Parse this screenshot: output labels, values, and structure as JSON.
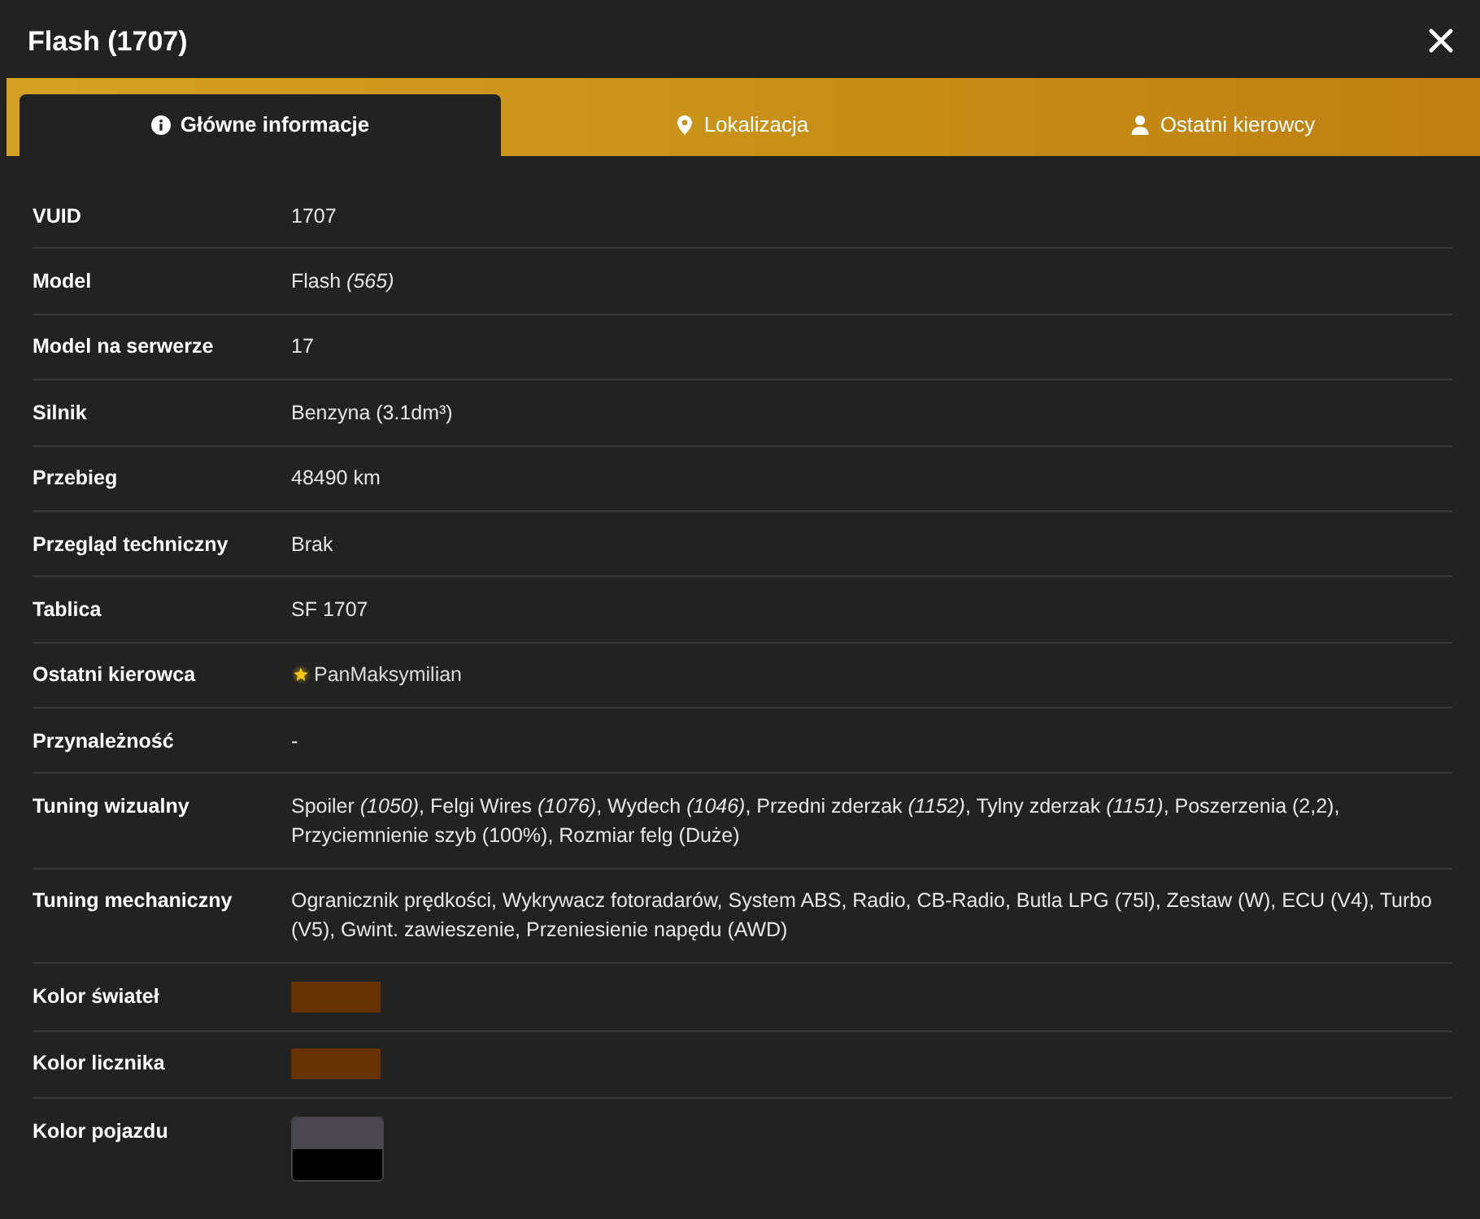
{
  "window": {
    "title": "Flash (1707)"
  },
  "tabs": [
    {
      "label": "Główne informacje",
      "selected": true
    },
    {
      "label": "Lokalizacja",
      "selected": false
    },
    {
      "label": "Ostatni kierowcy",
      "selected": false
    }
  ],
  "rows": [
    {
      "kind": "text",
      "label": "VUID",
      "value": "1707"
    },
    {
      "kind": "text",
      "label": "Model",
      "value": "Flash *(565)*"
    },
    {
      "kind": "text",
      "label": "Model na serwerze",
      "value": "17"
    },
    {
      "kind": "text",
      "label": "Silnik",
      "value": "Benzyna (3.1dm³)"
    },
    {
      "kind": "text",
      "label": "Przebieg",
      "value": "48490 km"
    },
    {
      "kind": "text",
      "label": "Przegląd techniczny",
      "value": "Brak"
    },
    {
      "kind": "text",
      "label": "Tablica",
      "value": "SF 1707"
    },
    {
      "kind": "driver",
      "label": "Ostatni kierowca",
      "value": "PanMaksymilian",
      "starred": true
    },
    {
      "kind": "text",
      "label": "Przynależność",
      "value": "-"
    },
    {
      "kind": "text",
      "label": "Tuning wizualny",
      "value": "Spoiler *(1050)*, Felgi Wires *(1076)*, Wydech *(1046)*, Przedni zderzak *(1152)*, Tylny zderzak *(1151)*, Poszerzenia (2,2), Przyciemnienie szyb (100%), Rozmiar felg (Duże)"
    },
    {
      "kind": "text",
      "label": "Tuning mechaniczny",
      "value": "Ogranicznik prędkości, Wykrywacz fotoradarów, System ABS, Radio, CB-Radio, Butla LPG (75l), Zestaw (W), ECU (V4), Turbo (V5), Gwint. zawieszenie, Przeniesienie napędu (AWD)"
    },
    {
      "kind": "swatch",
      "label": "Kolor świateł",
      "swatches": [
        {
          "color": "#663300"
        }
      ]
    },
    {
      "kind": "swatch",
      "label": "Kolor licznika",
      "swatches": [
        {
          "color": "#663300"
        }
      ]
    },
    {
      "kind": "swatch_stack",
      "label": "Kolor pojazdu",
      "swatches": [
        {
          "color": "#4b474e"
        },
        {
          "color": "#000000"
        }
      ]
    }
  ]
}
